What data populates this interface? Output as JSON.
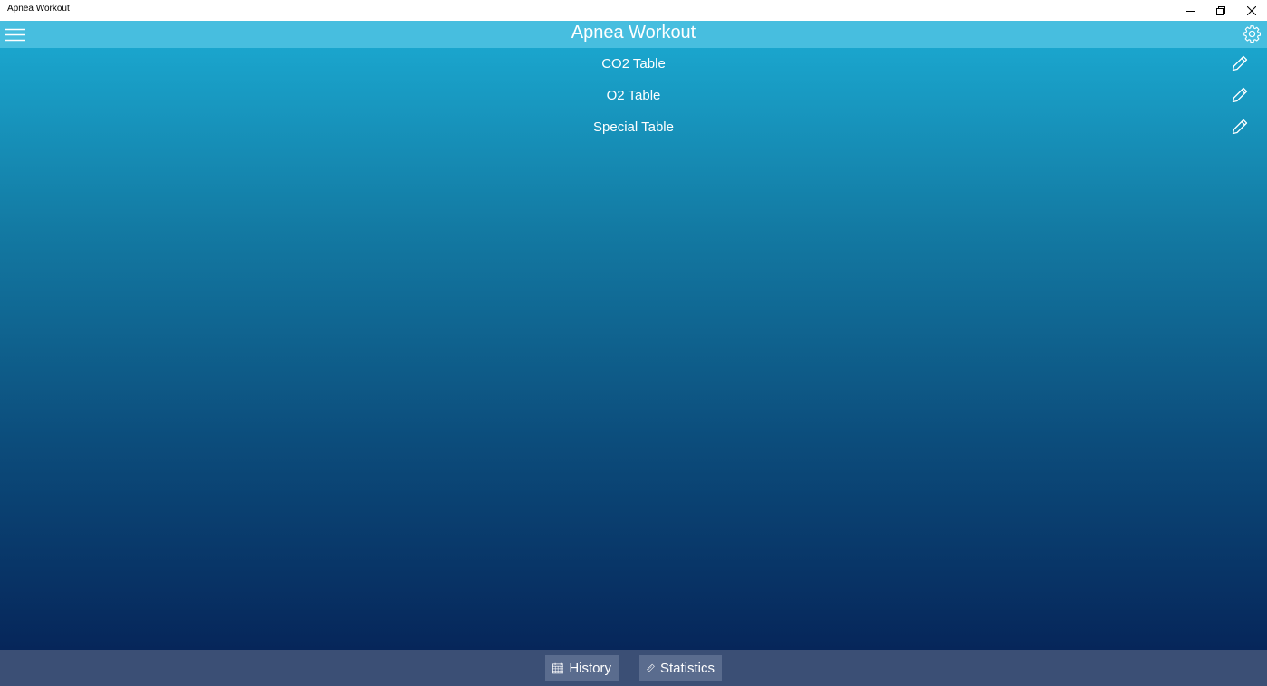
{
  "window": {
    "title": "Apnea Workout"
  },
  "header": {
    "title": "Apnea Workout",
    "menu_icon": "hamburger-icon",
    "settings_icon": "gear-icon"
  },
  "tables": [
    {
      "label": "CO2 Table",
      "edit_icon": "pencil-icon"
    },
    {
      "label": "O2 Table",
      "edit_icon": "pencil-icon"
    },
    {
      "label": "Special Table",
      "edit_icon": "pencil-icon"
    }
  ],
  "bottom_bar": {
    "history_label": "History",
    "history_icon": "calendar-icon",
    "statistics_label": "Statistics",
    "statistics_icon": "ruler-icon"
  },
  "colors": {
    "header": "#47bedf",
    "gradient_top": "#1aa5cd",
    "gradient_bottom": "#06265a",
    "bottom_bar": "#3b4f75",
    "button": "#5a6c8e"
  }
}
